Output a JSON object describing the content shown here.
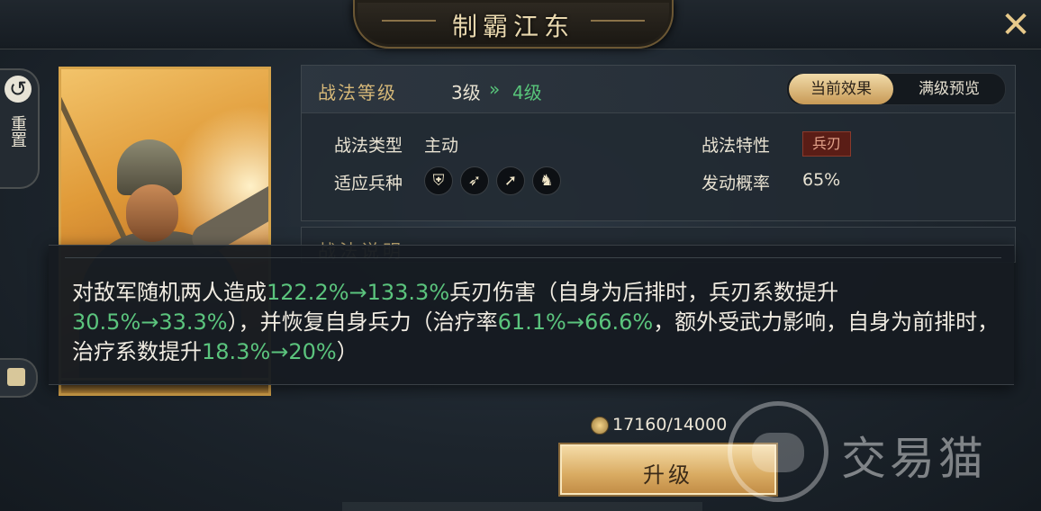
{
  "title": "制霸江东",
  "reset_button": {
    "icon": "undo-icon",
    "label": "重置"
  },
  "skill_level": {
    "label": "战法等级",
    "current": "3级",
    "arrow": "»",
    "next": "4级"
  },
  "tabs": [
    {
      "label": "当前效果",
      "active": true
    },
    {
      "label": "满级预览",
      "active": false
    }
  ],
  "skill_type": {
    "label": "战法类型",
    "value": "主动"
  },
  "skill_trait": {
    "label": "战法特性",
    "value": "兵刃"
  },
  "troop_types": {
    "label": "适应兵种",
    "icons": [
      "shield-icon",
      "bow-icon",
      "spear-icon",
      "horse-icon"
    ]
  },
  "trigger_rate": {
    "label": "发动概率",
    "value": "65%"
  },
  "description_header": "战法说明",
  "description": {
    "p1": "对敌军随机两人造成",
    "v1": "122.2%→133.3%",
    "p2": "兵刃伤害（自身为后排时，兵刃系数提升",
    "v2": "30.5%→33.3%",
    "p3": "），并恢复自身兵力（治疗率",
    "v3": "61.1%→66.6%",
    "p4": "，额外受武力影响，自身为前排时，治疗系数提升",
    "v4": "18.3%→20%",
    "p5": "）"
  },
  "cost": {
    "icon": "coin-icon",
    "value": "17160/14000"
  },
  "upgrade_button": "升级",
  "watermark": "交易猫",
  "colors": {
    "accent_gold": "#d6b878",
    "highlight_green": "#5bc47d",
    "trait_red": "#5a1d16"
  }
}
